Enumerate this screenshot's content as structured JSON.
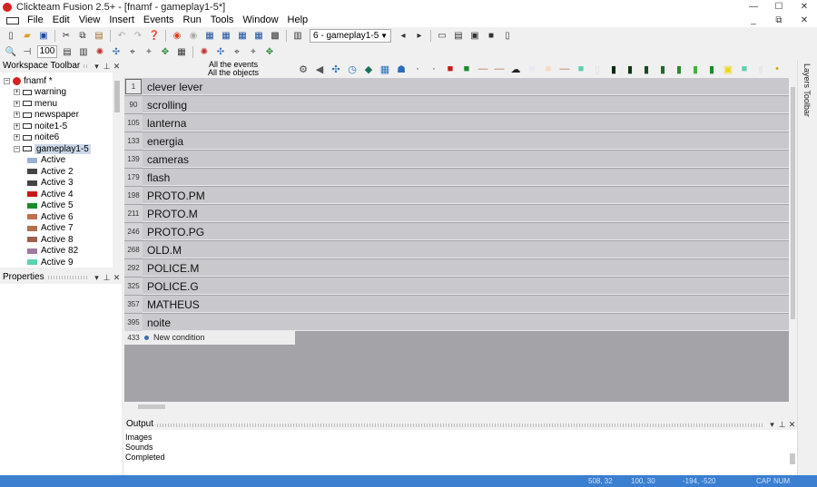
{
  "window": {
    "title": "Clickteam Fusion 2.5+ - [fnamf - gameplay1-5*]"
  },
  "menu": [
    "File",
    "Edit",
    "View",
    "Insert",
    "Events",
    "Run",
    "Tools",
    "Window",
    "Help"
  ],
  "toolbar": {
    "frame_select": "6 - gameplay1-5",
    "zoom": "100"
  },
  "workspace": {
    "title": "Workspace Toolbar",
    "tree": [
      {
        "label": "fnamf *",
        "level": 0,
        "type": "app"
      },
      {
        "label": "warning",
        "level": 1,
        "type": "frame"
      },
      {
        "label": "menu",
        "level": 1,
        "type": "frame"
      },
      {
        "label": "newspaper",
        "level": 1,
        "type": "frame"
      },
      {
        "label": "noite1-5",
        "level": 1,
        "type": "frame"
      },
      {
        "label": "noite6",
        "level": 1,
        "type": "frame"
      },
      {
        "label": "gameplay1-5",
        "level": 1,
        "type": "frame",
        "selected": true
      },
      {
        "label": "Active",
        "level": 2,
        "type": "obj",
        "color": "#9ab0d0"
      },
      {
        "label": "Active 2",
        "level": 2,
        "type": "obj",
        "color": "#444"
      },
      {
        "label": "Active 3",
        "level": 2,
        "type": "obj",
        "color": "#444"
      },
      {
        "label": "Active 4",
        "level": 2,
        "type": "obj",
        "color": "#c81818"
      },
      {
        "label": "Active 5",
        "level": 2,
        "type": "obj",
        "color": "#1e8a2e"
      },
      {
        "label": "Active 6",
        "level": 2,
        "type": "obj",
        "color": "#c07050"
      },
      {
        "label": "Active 7",
        "level": 2,
        "type": "obj",
        "color": "#b07050"
      },
      {
        "label": "Active 8",
        "level": 2,
        "type": "obj",
        "color": "#a06050"
      },
      {
        "label": "Active 82",
        "level": 2,
        "type": "obj",
        "color": "#a07aa0"
      },
      {
        "label": "Active 9",
        "level": 2,
        "type": "obj",
        "color": "#5fd0b0"
      }
    ]
  },
  "properties": {
    "title": "Properties"
  },
  "events": {
    "header": [
      "All the events",
      "All the objects"
    ],
    "rows": [
      {
        "num": "1",
        "name": "clever lever"
      },
      {
        "num": "90",
        "name": "scrolling"
      },
      {
        "num": "105",
        "name": "lanterna"
      },
      {
        "num": "133",
        "name": "energia"
      },
      {
        "num": "139",
        "name": "cameras"
      },
      {
        "num": "179",
        "name": "flash"
      },
      {
        "num": "198",
        "name": "PROTO.PM"
      },
      {
        "num": "211",
        "name": "PROTO.M"
      },
      {
        "num": "246",
        "name": "PROTO.PG"
      },
      {
        "num": "268",
        "name": "OLD.M"
      },
      {
        "num": "292",
        "name": "POLICE.M"
      },
      {
        "num": "325",
        "name": "POLICE.G"
      },
      {
        "num": "357",
        "name": "MATHEUS"
      },
      {
        "num": "395",
        "name": "noite"
      }
    ],
    "new_condition": {
      "num": "433",
      "label": "New condition"
    }
  },
  "object_icons": [
    {
      "name": "create-object-icon",
      "glyph": "⚙",
      "color": "#444"
    },
    {
      "name": "sound-icon",
      "glyph": "◀",
      "color": "#555"
    },
    {
      "name": "storyboard-icon",
      "glyph": "✣",
      "color": "#2a6ebb"
    },
    {
      "name": "timer-icon",
      "glyph": "◷",
      "color": "#2a6ebb"
    },
    {
      "name": "special-icon",
      "glyph": "◆",
      "color": "#1f6f5a"
    },
    {
      "name": "keyboard-icon",
      "glyph": "▦",
      "color": "#2a6ebb"
    },
    {
      "name": "player-icon",
      "glyph": "☗",
      "color": "#2a6ebb"
    },
    {
      "name": "active-2-icon",
      "glyph": "·",
      "color": "#222"
    },
    {
      "name": "active-3-icon",
      "glyph": "·",
      "color": "#222"
    },
    {
      "name": "active-4-icon",
      "glyph": "■",
      "color": "#c81818"
    },
    {
      "name": "active-5-icon",
      "glyph": "■",
      "color": "#1e8a2e"
    },
    {
      "name": "active-6-icon",
      "glyph": "—",
      "color": "#c07050"
    },
    {
      "name": "active-7-icon",
      "glyph": "—",
      "color": "#b07050"
    },
    {
      "name": "counter-icon",
      "glyph": "☁",
      "color": "#222"
    },
    {
      "name": "active-8-icon",
      "glyph": "■",
      "color": "#e8e8f8"
    },
    {
      "name": "active-9-icon",
      "glyph": "■",
      "color": "#f8dcc0"
    },
    {
      "name": "active-10-icon",
      "glyph": "—",
      "color": "#c07050"
    },
    {
      "name": "active-11-icon",
      "glyph": "■",
      "color": "#5fd0b0"
    },
    {
      "name": "active-12-icon",
      "glyph": "▯",
      "color": "#dddddd"
    },
    {
      "name": "active-13-icon",
      "glyph": "▮",
      "color": "#0a2a10"
    },
    {
      "name": "active-14-icon",
      "glyph": "▮",
      "color": "#0e3a16"
    },
    {
      "name": "active-15-icon",
      "glyph": "▮",
      "color": "#154a20"
    },
    {
      "name": "active-16-icon",
      "glyph": "▮",
      "color": "#1e6a28"
    },
    {
      "name": "active-17-icon",
      "glyph": "▮",
      "color": "#2a8a34"
    },
    {
      "name": "active-18-icon",
      "glyph": "▮",
      "color": "#45b040"
    },
    {
      "name": "active-19-icon",
      "glyph": "▮",
      "color": "#1e8a2e"
    },
    {
      "name": "active-20-icon",
      "glyph": "▣",
      "color": "#e8d818"
    },
    {
      "name": "active-21-icon",
      "glyph": "■",
      "color": "#5fd0b0"
    },
    {
      "name": "active-22-icon",
      "glyph": "▮",
      "color": "#e8e8e8"
    },
    {
      "name": "active-23-icon",
      "glyph": "•",
      "color": "#c8a818"
    }
  ],
  "output": {
    "title": "Output",
    "lines": [
      "Images",
      "Sounds",
      "Completed"
    ]
  },
  "layers": {
    "title": "Layers Toolbar"
  },
  "status": {
    "coords1": "508, 32",
    "coords2": "100, 30",
    "coords3": "-194, -520",
    "caps": "CAP",
    "num": "NUM"
  }
}
